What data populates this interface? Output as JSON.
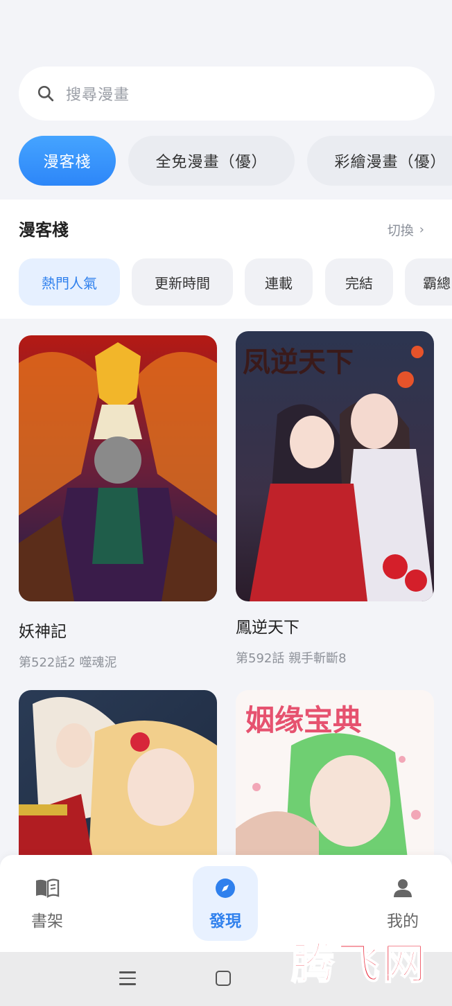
{
  "search": {
    "placeholder": "搜尋漫畫"
  },
  "source_tabs": [
    {
      "label": "漫客棧",
      "active": true
    },
    {
      "label": "全免漫畫（優）",
      "active": false
    },
    {
      "label": "彩繪漫畫（優）",
      "active": false
    }
  ],
  "section": {
    "title": "漫客棧",
    "switch_label": "切換"
  },
  "sort_tabs": [
    {
      "label": "熱門人氣",
      "active": true
    },
    {
      "label": "更新時間",
      "active": false
    },
    {
      "label": "連載",
      "active": false
    },
    {
      "label": "完結",
      "active": false
    },
    {
      "label": "霸總",
      "active": false
    }
  ],
  "comics": [
    {
      "title": "妖神記",
      "subtitle": "第522話2 噬魂泥",
      "cover_text": ""
    },
    {
      "title": "鳳逆天下",
      "subtitle": "第592話 親手斬斷8",
      "cover_text": "凤逆天下"
    },
    {
      "title": "",
      "subtitle": "",
      "cover_text": ""
    },
    {
      "title": "",
      "subtitle": "",
      "cover_text": "姻缘宝典"
    }
  ],
  "tabbar": {
    "items": [
      {
        "label": "書架",
        "icon": "book-icon",
        "active": false
      },
      {
        "label": "發現",
        "icon": "compass-icon",
        "active": true
      },
      {
        "label": "我的",
        "icon": "user-icon",
        "active": false
      }
    ]
  },
  "watermark": "腾飞网",
  "colors": {
    "accent": "#2f80ed",
    "background": "#f3f4f8",
    "watermark": "#e8192c"
  }
}
